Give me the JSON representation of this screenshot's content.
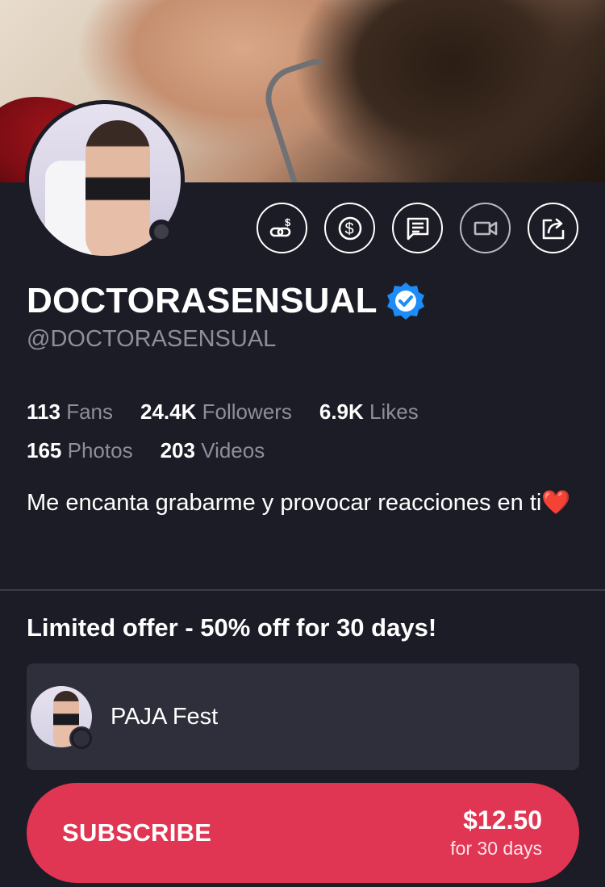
{
  "profile": {
    "display_name": "DOCTORASENSUAL",
    "handle": "@DOCTORASENSUAL",
    "verified": true,
    "online": false,
    "bio": "Me encanta grabarme y provocar reacciones en ti❤️"
  },
  "actions": [
    {
      "icon": "link-dollar-icon",
      "enabled": true
    },
    {
      "icon": "dollar-circle-icon",
      "enabled": true
    },
    {
      "icon": "message-icon",
      "enabled": true
    },
    {
      "icon": "video-camera-icon",
      "enabled": false
    },
    {
      "icon": "share-icon",
      "enabled": true
    }
  ],
  "stats": {
    "fans_value": "113",
    "fans_label": "Fans",
    "followers_value": "24.4K",
    "followers_label": "Followers",
    "likes_value": "6.9K",
    "likes_label": "Likes",
    "photos_value": "165",
    "photos_label": "Photos",
    "videos_value": "203",
    "videos_label": "Videos"
  },
  "offer": {
    "title": "Limited offer - 50% off for 30 days!",
    "promo_name": "PAJA Fest"
  },
  "subscribe": {
    "label": "SUBSCRIBE",
    "price": "$12.50",
    "period": "for 30 days"
  },
  "colors": {
    "background": "#1c1c26",
    "card": "#2f2f3b",
    "accent": "#e03553",
    "verified": "#1d8cf8",
    "muted_text": "#8e8e98"
  }
}
